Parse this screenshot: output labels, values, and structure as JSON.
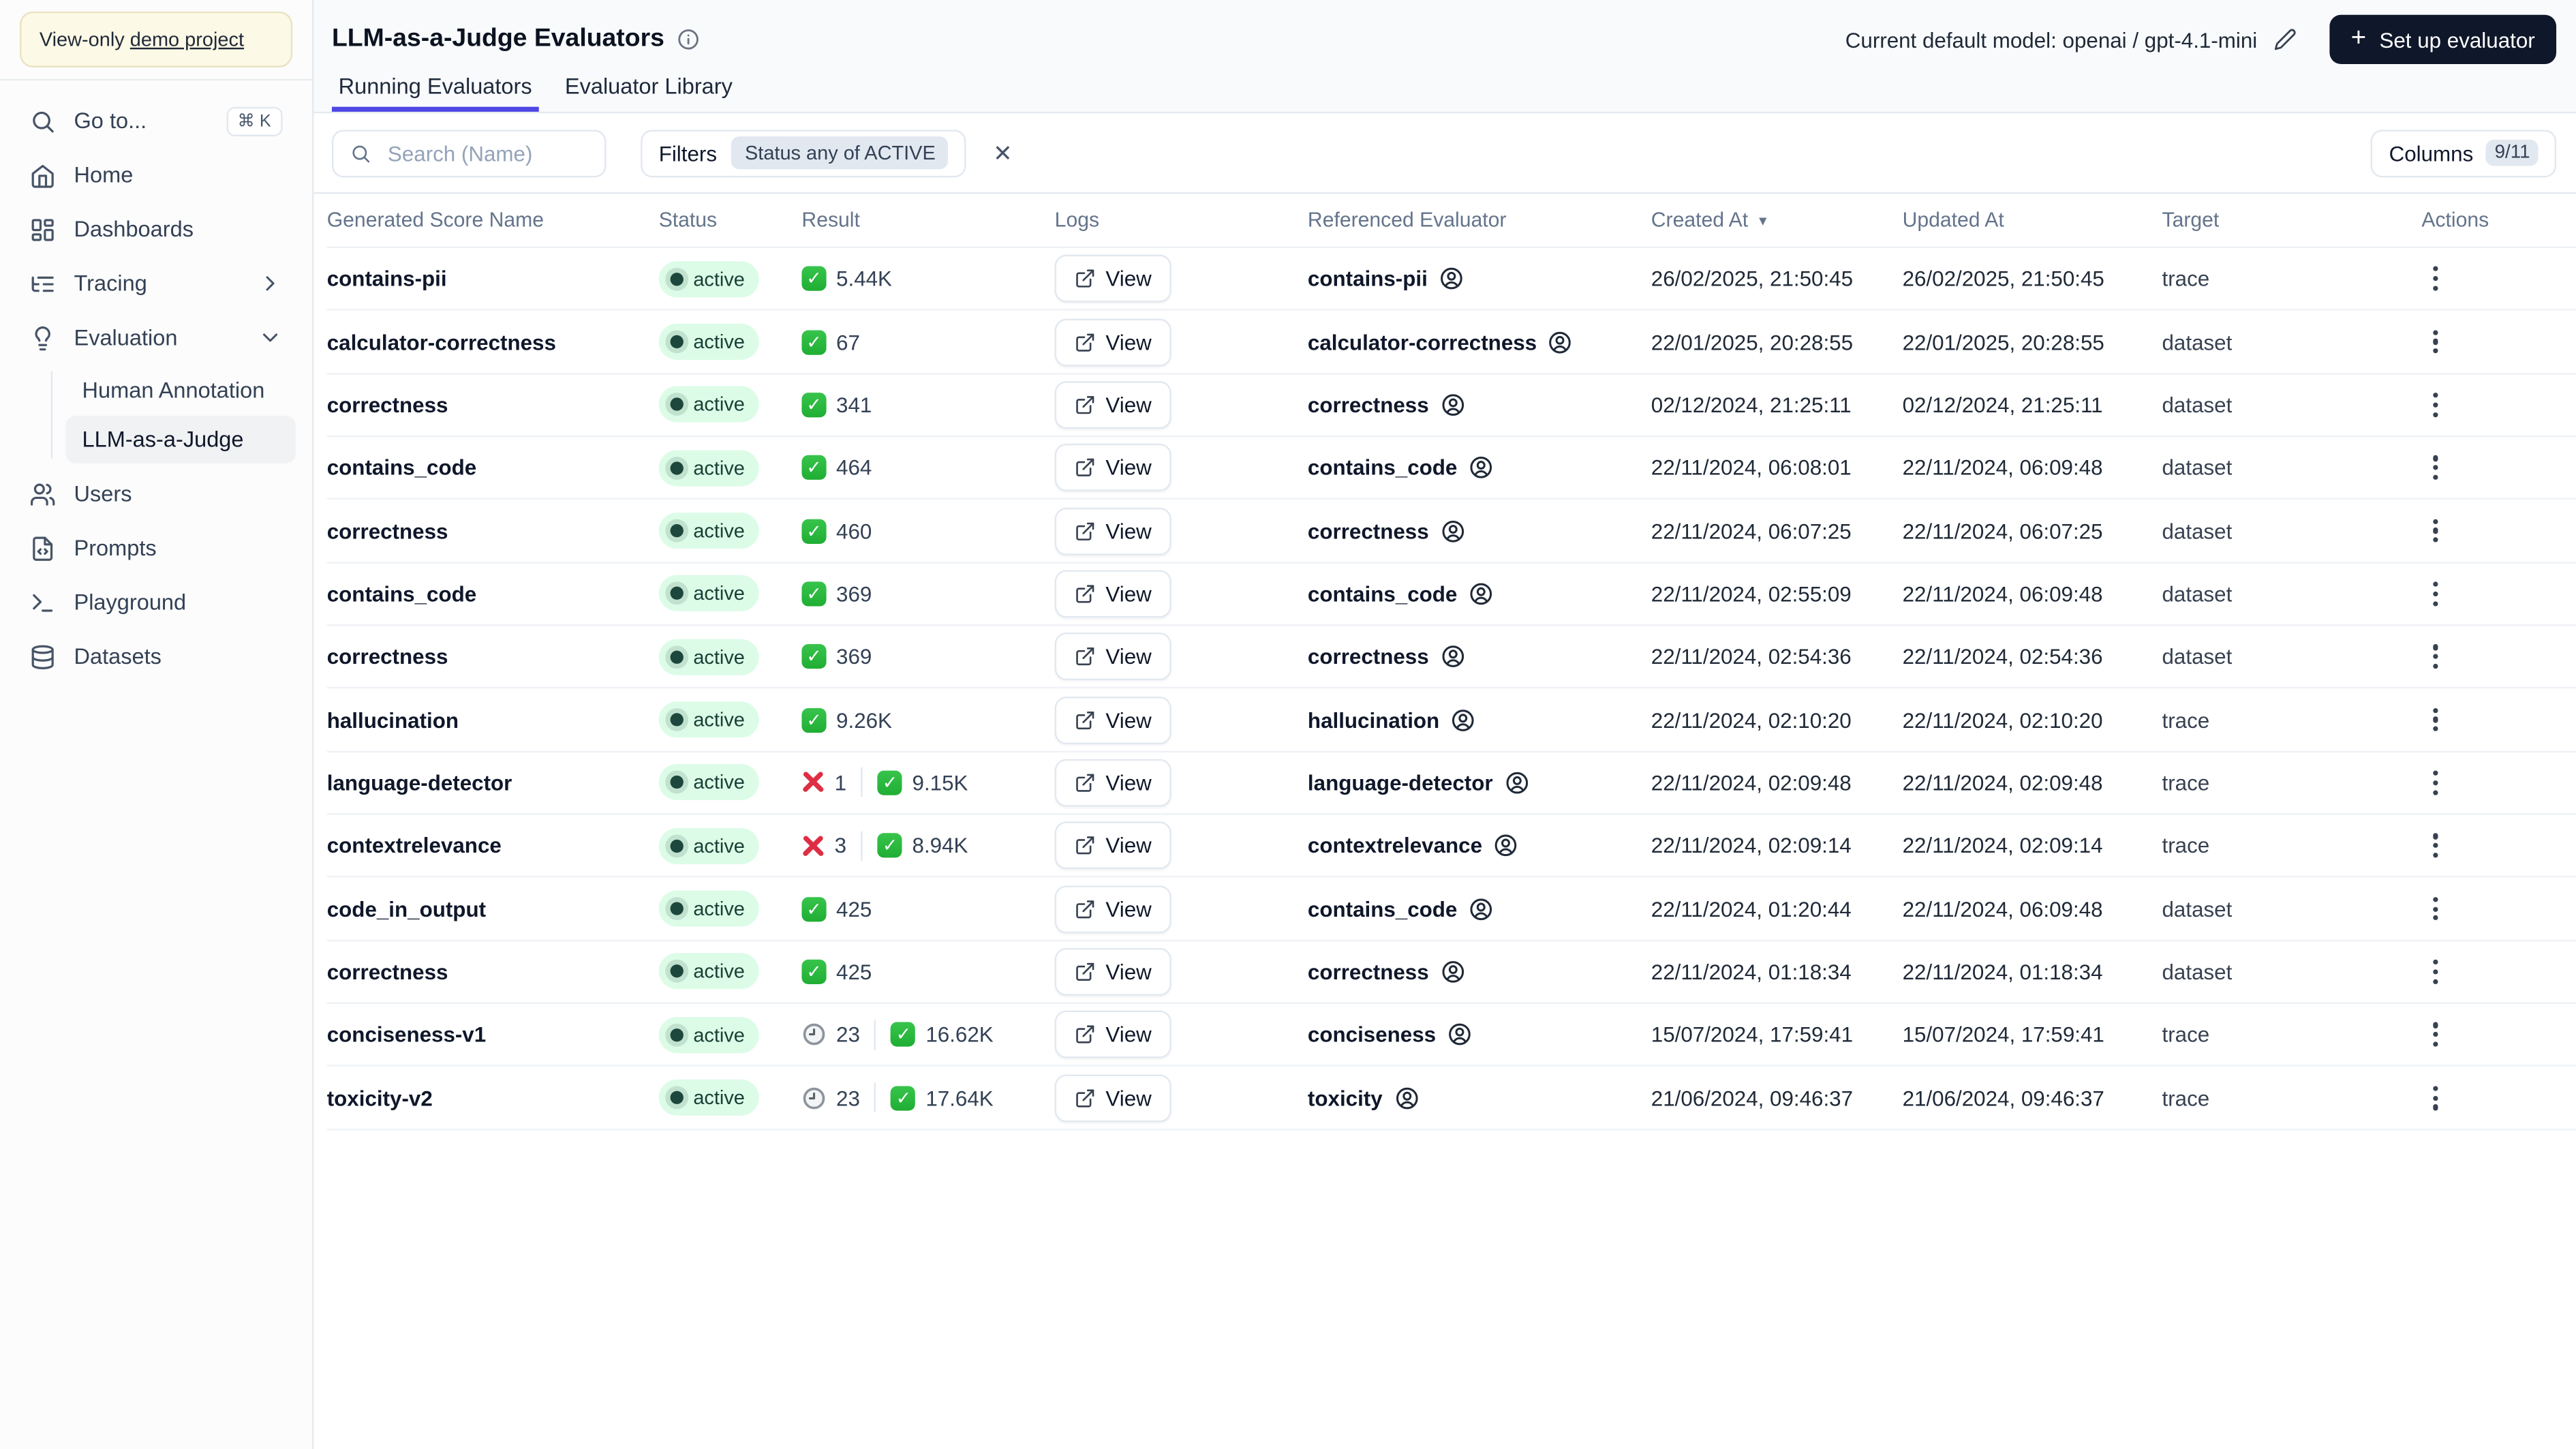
{
  "sidebar": {
    "banner": {
      "prefix": "View-only ",
      "link": "demo project"
    },
    "items": [
      {
        "label": "Go to...",
        "icon": "search",
        "shortcut": "⌘ K"
      },
      {
        "label": "Home",
        "icon": "home"
      },
      {
        "label": "Dashboards",
        "icon": "dashboards"
      },
      {
        "label": "Tracing",
        "icon": "tracing",
        "chevron": "right"
      },
      {
        "label": "Evaluation",
        "icon": "evaluation",
        "chevron": "down",
        "children": [
          {
            "label": "Human Annotation",
            "active": false
          },
          {
            "label": "LLM-as-a-Judge",
            "active": true
          }
        ]
      },
      {
        "label": "Users",
        "icon": "users"
      },
      {
        "label": "Prompts",
        "icon": "prompts"
      },
      {
        "label": "Playground",
        "icon": "playground"
      },
      {
        "label": "Datasets",
        "icon": "datasets"
      }
    ]
  },
  "header": {
    "title": "LLM-as-a-Judge Evaluators",
    "model_label": "Current default model: openai / gpt-4.1-mini",
    "setup_label": "Set up evaluator",
    "tabs": [
      {
        "label": "Running Evaluators",
        "active": true
      },
      {
        "label": "Evaluator Library",
        "active": false
      }
    ]
  },
  "toolbar": {
    "search_placeholder": "Search (Name)",
    "filters_label": "Filters",
    "filter_chip": "Status any of ACTIVE",
    "columns_label": "Columns",
    "columns_count": "9/11"
  },
  "table": {
    "columns": [
      "Generated Score Name",
      "Status",
      "Result",
      "Logs",
      "Referenced Evaluator",
      "Created At",
      "Updated At",
      "Target",
      "Actions"
    ],
    "sort_column": "Created At",
    "view_label": "View",
    "rows": [
      {
        "name": "contains-pii",
        "status": "active",
        "result": [
          {
            "t": "check",
            "v": "5.44K"
          }
        ],
        "evaluator": "contains-pii",
        "created": "26/02/2025, 21:50:45",
        "updated": "26/02/2025, 21:50:45",
        "target": "trace"
      },
      {
        "name": "calculator-correctness",
        "status": "active",
        "result": [
          {
            "t": "check",
            "v": "67"
          }
        ],
        "evaluator": "calculator-correctness",
        "created": "22/01/2025, 20:28:55",
        "updated": "22/01/2025, 20:28:55",
        "target": "dataset"
      },
      {
        "name": "correctness",
        "status": "active",
        "result": [
          {
            "t": "check",
            "v": "341"
          }
        ],
        "evaluator": "correctness",
        "created": "02/12/2024, 21:25:11",
        "updated": "02/12/2024, 21:25:11",
        "target": "dataset"
      },
      {
        "name": "contains_code",
        "status": "active",
        "result": [
          {
            "t": "check",
            "v": "464"
          }
        ],
        "evaluator": "contains_code",
        "created": "22/11/2024, 06:08:01",
        "updated": "22/11/2024, 06:09:48",
        "target": "dataset"
      },
      {
        "name": "correctness",
        "status": "active",
        "result": [
          {
            "t": "check",
            "v": "460"
          }
        ],
        "evaluator": "correctness",
        "created": "22/11/2024, 06:07:25",
        "updated": "22/11/2024, 06:07:25",
        "target": "dataset"
      },
      {
        "name": "contains_code",
        "status": "active",
        "result": [
          {
            "t": "check",
            "v": "369"
          }
        ],
        "evaluator": "contains_code",
        "created": "22/11/2024, 02:55:09",
        "updated": "22/11/2024, 06:09:48",
        "target": "dataset"
      },
      {
        "name": "correctness",
        "status": "active",
        "result": [
          {
            "t": "check",
            "v": "369"
          }
        ],
        "evaluator": "correctness",
        "created": "22/11/2024, 02:54:36",
        "updated": "22/11/2024, 02:54:36",
        "target": "dataset"
      },
      {
        "name": "hallucination",
        "status": "active",
        "result": [
          {
            "t": "check",
            "v": "9.26K"
          }
        ],
        "evaluator": "hallucination",
        "created": "22/11/2024, 02:10:20",
        "updated": "22/11/2024, 02:10:20",
        "target": "trace"
      },
      {
        "name": "language-detector",
        "status": "active",
        "result": [
          {
            "t": "error",
            "v": "1"
          },
          {
            "t": "check",
            "v": "9.15K"
          }
        ],
        "evaluator": "language-detector",
        "created": "22/11/2024, 02:09:48",
        "updated": "22/11/2024, 02:09:48",
        "target": "trace"
      },
      {
        "name": "contextrelevance",
        "status": "active",
        "result": [
          {
            "t": "error",
            "v": "3"
          },
          {
            "t": "check",
            "v": "8.94K"
          }
        ],
        "evaluator": "contextrelevance",
        "created": "22/11/2024, 02:09:14",
        "updated": "22/11/2024, 02:09:14",
        "target": "trace"
      },
      {
        "name": "code_in_output",
        "status": "active",
        "result": [
          {
            "t": "check",
            "v": "425"
          }
        ],
        "evaluator": "contains_code",
        "created": "22/11/2024, 01:20:44",
        "updated": "22/11/2024, 06:09:48",
        "target": "dataset"
      },
      {
        "name": "correctness",
        "status": "active",
        "result": [
          {
            "t": "check",
            "v": "425"
          }
        ],
        "evaluator": "correctness",
        "created": "22/11/2024, 01:18:34",
        "updated": "22/11/2024, 01:18:34",
        "target": "dataset"
      },
      {
        "name": "conciseness-v1",
        "status": "active",
        "result": [
          {
            "t": "pending",
            "v": "23"
          },
          {
            "t": "check",
            "v": "16.62K"
          }
        ],
        "evaluator": "conciseness",
        "created": "15/07/2024, 17:59:41",
        "updated": "15/07/2024, 17:59:41",
        "target": "trace"
      },
      {
        "name": "toxicity-v2",
        "status": "active",
        "result": [
          {
            "t": "pending",
            "v": "23"
          },
          {
            "t": "check",
            "v": "17.64K"
          }
        ],
        "evaluator": "toxicity",
        "created": "21/06/2024, 09:46:37",
        "updated": "21/06/2024, 09:46:37",
        "target": "trace"
      }
    ]
  },
  "colors": {
    "accent_tab": "#4f46e5",
    "button_dark": "#0f172a",
    "status_badge_bg": "#dcfce7",
    "status_badge_text": "#173f35",
    "success_green": "#2bbc40",
    "error_red": "#dd2e44",
    "banner_bg": "#fcf9e6"
  }
}
